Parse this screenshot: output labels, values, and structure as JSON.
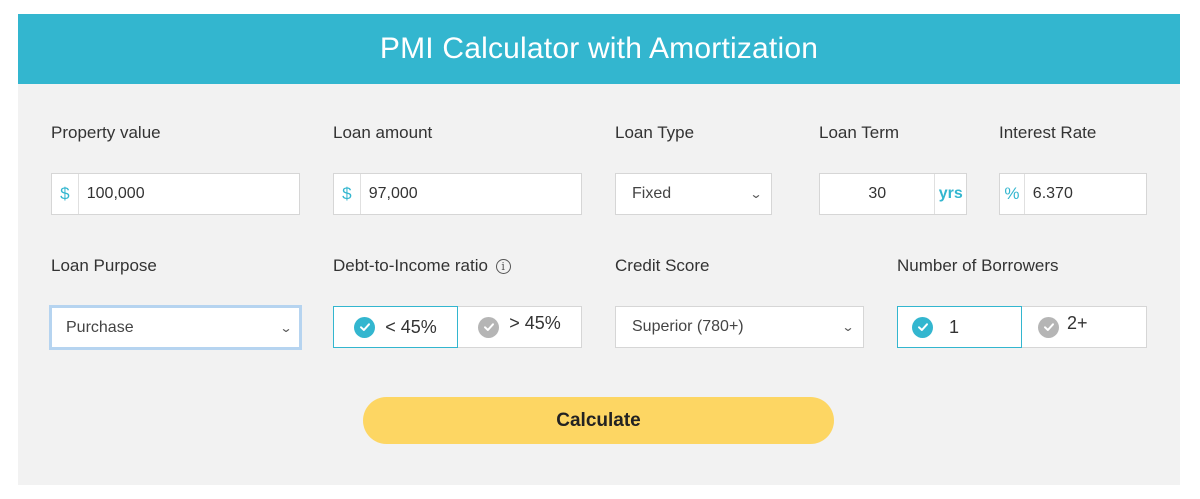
{
  "title": "PMI Calculator with Amortization",
  "fields": {
    "property_value": {
      "label": "Property value",
      "prefix": "$",
      "value": "100,000"
    },
    "loan_amount": {
      "label": "Loan amount",
      "prefix": "$",
      "value": "97,000"
    },
    "loan_type": {
      "label": "Loan Type",
      "selected": "Fixed"
    },
    "loan_term": {
      "label": "Loan Term",
      "value": "30",
      "suffix": "yrs"
    },
    "interest_rate": {
      "label": "Interest Rate",
      "prefix": "%",
      "value": "6.370"
    },
    "loan_purpose": {
      "label": "Loan Purpose",
      "selected": "Purchase"
    },
    "dti": {
      "label": "Debt-to-Income ratio",
      "info_glyph": "i",
      "options": [
        {
          "label": "< 45%",
          "selected": true
        },
        {
          "label": "> 45%",
          "selected": false
        }
      ]
    },
    "credit_score": {
      "label": "Credit Score",
      "selected": "Superior (780+)"
    },
    "borrowers": {
      "label": "Number of Borrowers",
      "options": [
        {
          "label": "1",
          "selected": true
        },
        {
          "label": "2+",
          "selected": false
        }
      ]
    }
  },
  "buttons": {
    "calculate": "Calculate"
  },
  "icons": {
    "dropdown": "chevron-down-icon",
    "check": "check-circle-icon",
    "info": "info-icon"
  },
  "colors": {
    "accent": "#33b6cf",
    "button": "#fdd663",
    "panel": "#f2f2f2",
    "unselected_check": "#b5b5b5"
  }
}
